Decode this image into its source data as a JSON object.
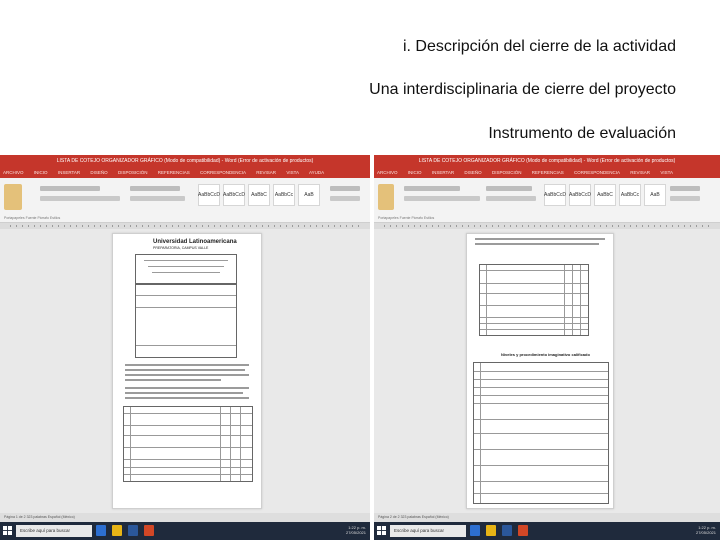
{
  "headings": {
    "line1": "i. Descripción del cierre de la actividad",
    "line2": "Una interdisciplinaria de cierre del proyecto",
    "line3": "Instrumento de evaluación"
  },
  "left_window": {
    "title": "LISTA DE COTEJO ORGANIZADOR GRÁFICO (Modo de compatibilidad) - Word (Error de activación de productos)",
    "menu": [
      "ARCHIVO",
      "INICIO",
      "INSERTAR",
      "DISEÑO",
      "DISPOSICIÓN",
      "REFERENCIAS",
      "CORRESPONDENCIA",
      "REVISAR",
      "VISTA",
      "AYUDA"
    ],
    "styles": [
      "AaBbCcD",
      "AaBbCcD",
      "AaBbC",
      "AaBbCc",
      "AaB"
    ],
    "ribbon_labels": "Portapapeles      Fuente      Párrafo      Estilos",
    "doc_header": "Universidad Latinoamericana",
    "doc_subheader": "PREPARATORIA, CAMPUS VALLE",
    "status": "Página 1 de 2     323 palabras     Español (México)",
    "search": "Escribe aquí para buscar",
    "clock": "1:22 p. m.",
    "date": "27/05/2021",
    "colors": {
      "word_red": "#c5362b",
      "taskbar": "#1f2a3c"
    }
  },
  "right_window": {
    "title": "LISTA DE COTEJO ORGANIZADOR GRÁFICO (Modo de compatibilidad) - Word (Error de activación de productos)",
    "menu": [
      "ARCHIVO",
      "INICIO",
      "INSERTAR",
      "DISEÑO",
      "DISPOSICIÓN",
      "REFERENCIAS",
      "CORRESPONDENCIA",
      "REVISAR",
      "VISTA"
    ],
    "styles": [
      "AaBbCcD",
      "AaBbCcD",
      "AaBbC",
      "AaBbCc",
      "AaB"
    ],
    "ribbon_labels": "Portapapeles      Fuente      Párrafo      Estilos",
    "doc_section": "Niveles y procedimiento imaginativo calificado",
    "status": "Página 2 de 2     323 palabras     Español (México)",
    "search": "Escribe aquí para buscar",
    "clock": "1:22 p. m.",
    "date": "27/05/2021"
  }
}
